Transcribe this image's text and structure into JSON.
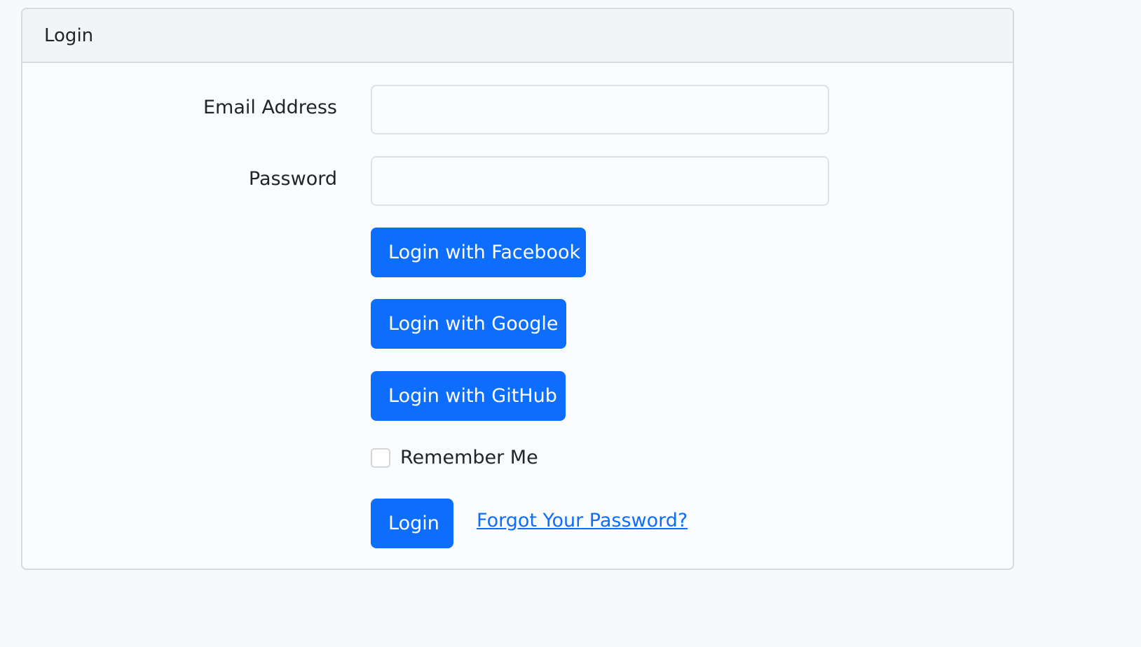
{
  "card": {
    "title": "Login"
  },
  "form": {
    "email_label": "Email Address",
    "email_value": "",
    "email_placeholder": "",
    "password_label": "Password",
    "password_value": "",
    "password_placeholder": "",
    "facebook_button": "Login with Facebook",
    "google_button": "Login with Google",
    "github_button": "Login with GitHub",
    "remember_label": "Remember Me",
    "remember_checked": false,
    "login_button": "Login",
    "forgot_link": "Forgot Your Password?"
  },
  "colors": {
    "primary": "#0d6efd",
    "background": "#f8f9fa",
    "header_bg": "#f3f4f5",
    "border": "#d9dadb",
    "text": "#212529"
  }
}
